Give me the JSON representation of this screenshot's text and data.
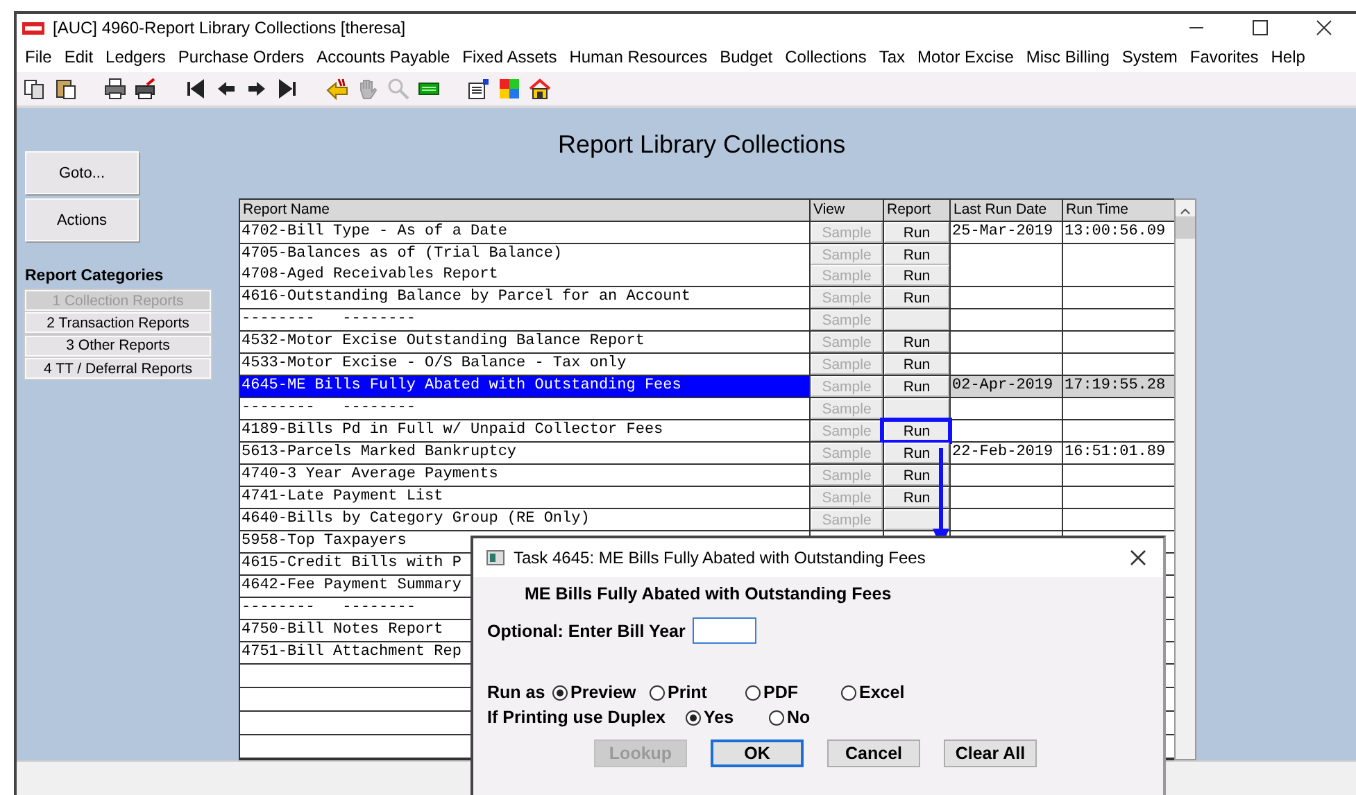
{
  "window": {
    "title": "[AUC] 4960-Report Library Collections [theresa]"
  },
  "menu": [
    "File",
    "Edit",
    "Ledgers",
    "Purchase Orders",
    "Accounts Payable",
    "Fixed Assets",
    "Human Resources",
    "Budget",
    "Collections",
    "Tax",
    "Motor Excise",
    "Misc Billing",
    "System",
    "Favorites",
    "Help"
  ],
  "page_title": "Report Library Collections",
  "side_buttons": [
    "Goto...",
    "Actions"
  ],
  "categories": {
    "heading": "Report Categories",
    "items": [
      {
        "label": "1 Collection Reports",
        "disabled": true
      },
      {
        "label": "2 Transaction Reports",
        "disabled": false
      },
      {
        "label": "3 Other Reports",
        "disabled": false
      },
      {
        "label": "4 TT / Deferral Reports",
        "disabled": false
      }
    ]
  },
  "table": {
    "columns": [
      "Report Name",
      "View",
      "Report",
      "Last Run Date",
      "Run Time"
    ],
    "rows": [
      {
        "lines": [
          {
            "name": "4702-Bill Type - As of a Date",
            "view": "Sample",
            "report": "Run"
          }
        ],
        "last_run_date": "25-Mar-2019",
        "run_time": "13:00:56.09",
        "selected": false,
        "highlighted": false
      },
      {
        "lines": [
          {
            "name": "4705-Balances as of (Trial Balance)",
            "view": "Sample",
            "report": "Run"
          },
          {
            "name": "4708-Aged Receivables Report",
            "view": "Sample",
            "report": "Run"
          }
        ],
        "selected": false,
        "highlighted": false
      },
      {
        "lines": [
          {
            "name": "4616-Outstanding Balance by Parcel for an Account",
            "view": "Sample",
            "report": "Run"
          }
        ],
        "selected": false,
        "highlighted": false
      },
      {
        "lines": [
          {
            "name": "--------   --------",
            "view": "Sample"
          }
        ],
        "selected": false,
        "highlighted": false
      },
      {
        "lines": [
          {
            "name": "4532-Motor Excise Outstanding Balance Report",
            "view": "Sample",
            "report": "Run"
          }
        ],
        "selected": false,
        "highlighted": false
      },
      {
        "lines": [
          {
            "name": "4533-Motor Excise - O/S Balance - Tax only",
            "view": "Sample",
            "report": "Run"
          }
        ],
        "selected": false,
        "highlighted": false
      },
      {
        "lines": [
          {
            "name": "4645-ME Bills Fully Abated with Outstanding Fees",
            "view": "Sample",
            "report": "Run"
          }
        ],
        "last_run_date": "02-Apr-2019",
        "run_time": "17:19:55.28",
        "selected": true,
        "highlighted": false
      },
      {
        "lines": [
          {
            "name": "--------   --------",
            "view": "Sample"
          }
        ],
        "selected": false,
        "highlighted": false
      },
      {
        "lines": [
          {
            "name": "4189-Bills Pd in Full w/ Unpaid Collector Fees",
            "view": "Sample",
            "report": "Run"
          }
        ],
        "selected": false,
        "highlighted": true
      },
      {
        "lines": [
          {
            "name": "5613-Parcels Marked Bankruptcy",
            "view": "Sample",
            "report": "Run"
          }
        ],
        "last_run_date": "22-Feb-2019",
        "run_time": "16:51:01.89",
        "selected": false,
        "highlighted": false
      },
      {
        "lines": [
          {
            "name": "4740-3 Year Average Payments",
            "view": "Sample",
            "report": "Run"
          }
        ],
        "selected": false,
        "highlighted": false
      },
      {
        "lines": [
          {
            "name": "4741-Late Payment List",
            "view": "Sample",
            "report": "Run"
          }
        ],
        "selected": false,
        "highlighted": false
      },
      {
        "lines": [
          {
            "name": "4640-Bills by Category Group (RE Only)",
            "view": "Sample"
          }
        ],
        "selected": false,
        "highlighted": false
      },
      {
        "lines": [
          {
            "name": "5958-Top Taxpayers"
          }
        ],
        "selected": false,
        "highlighted": false
      },
      {
        "lines": [
          {
            "name": "4615-Credit Bills with P"
          }
        ],
        "selected": false,
        "highlighted": false
      },
      {
        "lines": [
          {
            "name": "4642-Fee Payment Summary"
          }
        ],
        "selected": false,
        "highlighted": false
      },
      {
        "lines": [
          {
            "name": "--------   --------"
          }
        ],
        "selected": false,
        "highlighted": false
      },
      {
        "lines": [
          {
            "name": "4750-Bill Notes Report"
          }
        ],
        "selected": false,
        "highlighted": false
      },
      {
        "lines": [
          {
            "name": "4751-Bill Attachment Rep"
          }
        ],
        "selected": false,
        "highlighted": false
      }
    ]
  },
  "dialog": {
    "title": "Task 4645: ME Bills Fully Abated with Outstanding Fees",
    "heading": "ME Bills Fully Abated with Outstanding Fees",
    "field": {
      "label": "Optional: Enter Bill Year"
    },
    "run_as": {
      "label": "Run as",
      "options": [
        {
          "label": "Preview",
          "selected": true
        },
        {
          "label": "Print",
          "selected": false
        },
        {
          "label": "PDF",
          "selected": false
        },
        {
          "label": "Excel",
          "selected": false
        }
      ]
    },
    "duplex": {
      "label": "If Printing use Duplex",
      "options": [
        {
          "label": "Yes",
          "selected": true
        },
        {
          "label": "No",
          "selected": false
        }
      ]
    },
    "buttons": [
      {
        "label": "Lookup",
        "disabled": true,
        "default": false
      },
      {
        "label": "OK",
        "disabled": false,
        "default": true
      },
      {
        "label": "Cancel",
        "disabled": false,
        "default": false
      },
      {
        "label": "Clear All",
        "disabled": false,
        "default": false
      }
    ]
  }
}
